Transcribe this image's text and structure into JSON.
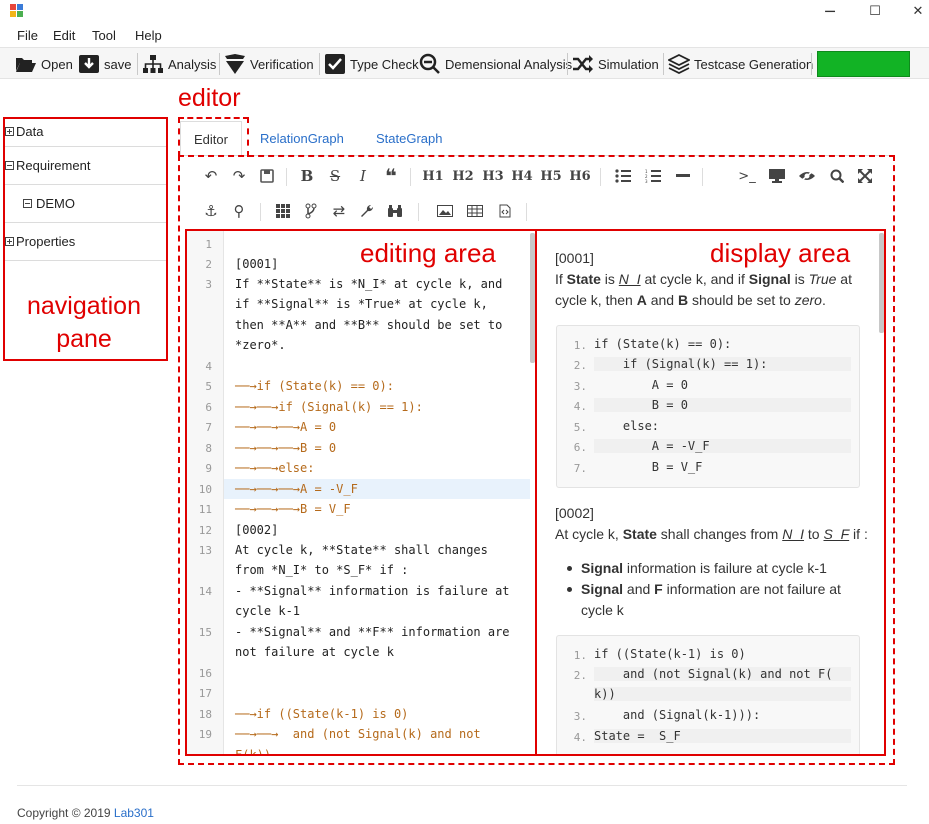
{
  "window": {
    "minimize": "─",
    "maximize": "☐",
    "close": "✕"
  },
  "menu": [
    "File",
    "Edit",
    "Tool",
    "Help"
  ],
  "toolbar": {
    "open": "Open",
    "save": "save",
    "analysis": "Analysis",
    "verification": "Verification",
    "type_check": "Type Check",
    "dimensional_analysis": "Demensional Analysis",
    "simulation": "Simulation",
    "testcase_generation": "Testcase Generation",
    "status_color": "#12b325"
  },
  "nav": {
    "items": [
      {
        "label": "Data",
        "expanded": false
      },
      {
        "label": "Requirement",
        "expanded": true
      },
      {
        "label": "DEMO",
        "expanded": true
      },
      {
        "label": "Properties",
        "expanded": false
      }
    ]
  },
  "annotations": {
    "editor": "editor",
    "editing_area": "editing area",
    "display_area": "display area",
    "navigation_line1": "navigation",
    "navigation_line2": "pane"
  },
  "tabs": [
    "Editor",
    "RelationGraph",
    "StateGraph"
  ],
  "editor_toolbar": {
    "row1": [
      "undo-icon",
      "redo-icon",
      "save-icon",
      "bold-icon",
      "strikethrough-icon",
      "italic-icon",
      "quote-icon",
      "H1",
      "H2",
      "H3",
      "H4",
      "H5",
      "H6",
      "unordered-list-icon",
      "ordered-list-icon",
      "hr-icon",
      "terminal-icon",
      "preview-icon",
      "eye-icon",
      "search-icon",
      "fullscreen-icon"
    ],
    "row2": [
      "anchor-icon",
      "gender-icon",
      "grid-icon",
      "branch-icon",
      "retweet-icon",
      "wrench-icon",
      "binoculars-icon",
      "image-icon",
      "table-icon",
      "code-file-icon"
    ]
  },
  "editing": {
    "line_numbers": [
      "1",
      "2",
      "3",
      "4",
      "5",
      "6",
      "7",
      "8",
      "9",
      "10",
      "11",
      "12",
      "13",
      "14",
      "15",
      "16",
      "17",
      "18",
      "19"
    ],
    "lines": [
      "[0001]",
      "If **State** is *N_I* at cycle k, and",
      "if **Signal** is *True* at cycle k,",
      "then **A** and **B** should be set to",
      "*zero*.",
      "──→if (State(k) == 0):",
      "──→──→if (Signal(k) == 1):",
      "──→──→──→A = 0",
      "──→──→──→B = 0",
      "──→──→else:",
      "──→──→──→A = -V_F",
      "──→──→──→B = V_F",
      "[0002]",
      "At cycle k, **State** shall changes",
      "from *N_I* to *S_F* if :",
      "- **Signal** information is failure at",
      "cycle k-1",
      "- **Signal** and **F** information are",
      "not failure at cycle k",
      "──→if ((State(k-1) is 0)",
      "──→──→  and (not Signal(k) and not",
      "F(k))"
    ]
  },
  "display": {
    "req1": {
      "id": "[0001]",
      "p1_a": "If ",
      "state": "State",
      "p1_b": " is ",
      "ni": "N_I",
      "p1_c": " at cycle k, and if ",
      "signal": "Signal",
      "p1_d": " is ",
      "true": "True",
      "p1_e": " at",
      "p2_a": "cycle k, then ",
      "a": "A",
      "p2_b": " and ",
      "b": "B",
      "p2_c": " should be set to ",
      "zero": "zero",
      "p2_d": "."
    },
    "code1": {
      "nums": [
        "1.",
        "2.",
        "3.",
        "4.",
        "5.",
        "6.",
        "7."
      ],
      "lines": [
        "if (State(k) == 0):",
        "    if (Signal(k) == 1):",
        "        A = 0",
        "        B = 0",
        "    else:",
        "        A = -V_F",
        "        B = V_F"
      ]
    },
    "req2": {
      "id": "[0002]",
      "p1_a": "At cycle k, ",
      "state": "State",
      "p1_b": " shall changes from ",
      "ni": "N_I",
      "p1_c": " to ",
      "sf": "S_F",
      "p1_d": " if :",
      "b1_bold": "Signal",
      "b1_rest": " information is failure at cycle k-1",
      "b2_bold1": "Signal",
      "b2_mid": " and ",
      "b2_bold2": "F",
      "b2_rest": " information are not failure at",
      "b2_cont": "cycle k"
    },
    "code2": {
      "nums": [
        "1.",
        "2.",
        "3.",
        "4."
      ],
      "lines": [
        "if ((State(k-1) is 0)",
        "    and (not Signal(k) and not F(",
        "k))",
        "    and (Signal(k-1))):",
        "State =  S_F"
      ]
    }
  },
  "footer": {
    "copyright": "Copyright © 2019 ",
    "lab": "Lab301"
  }
}
